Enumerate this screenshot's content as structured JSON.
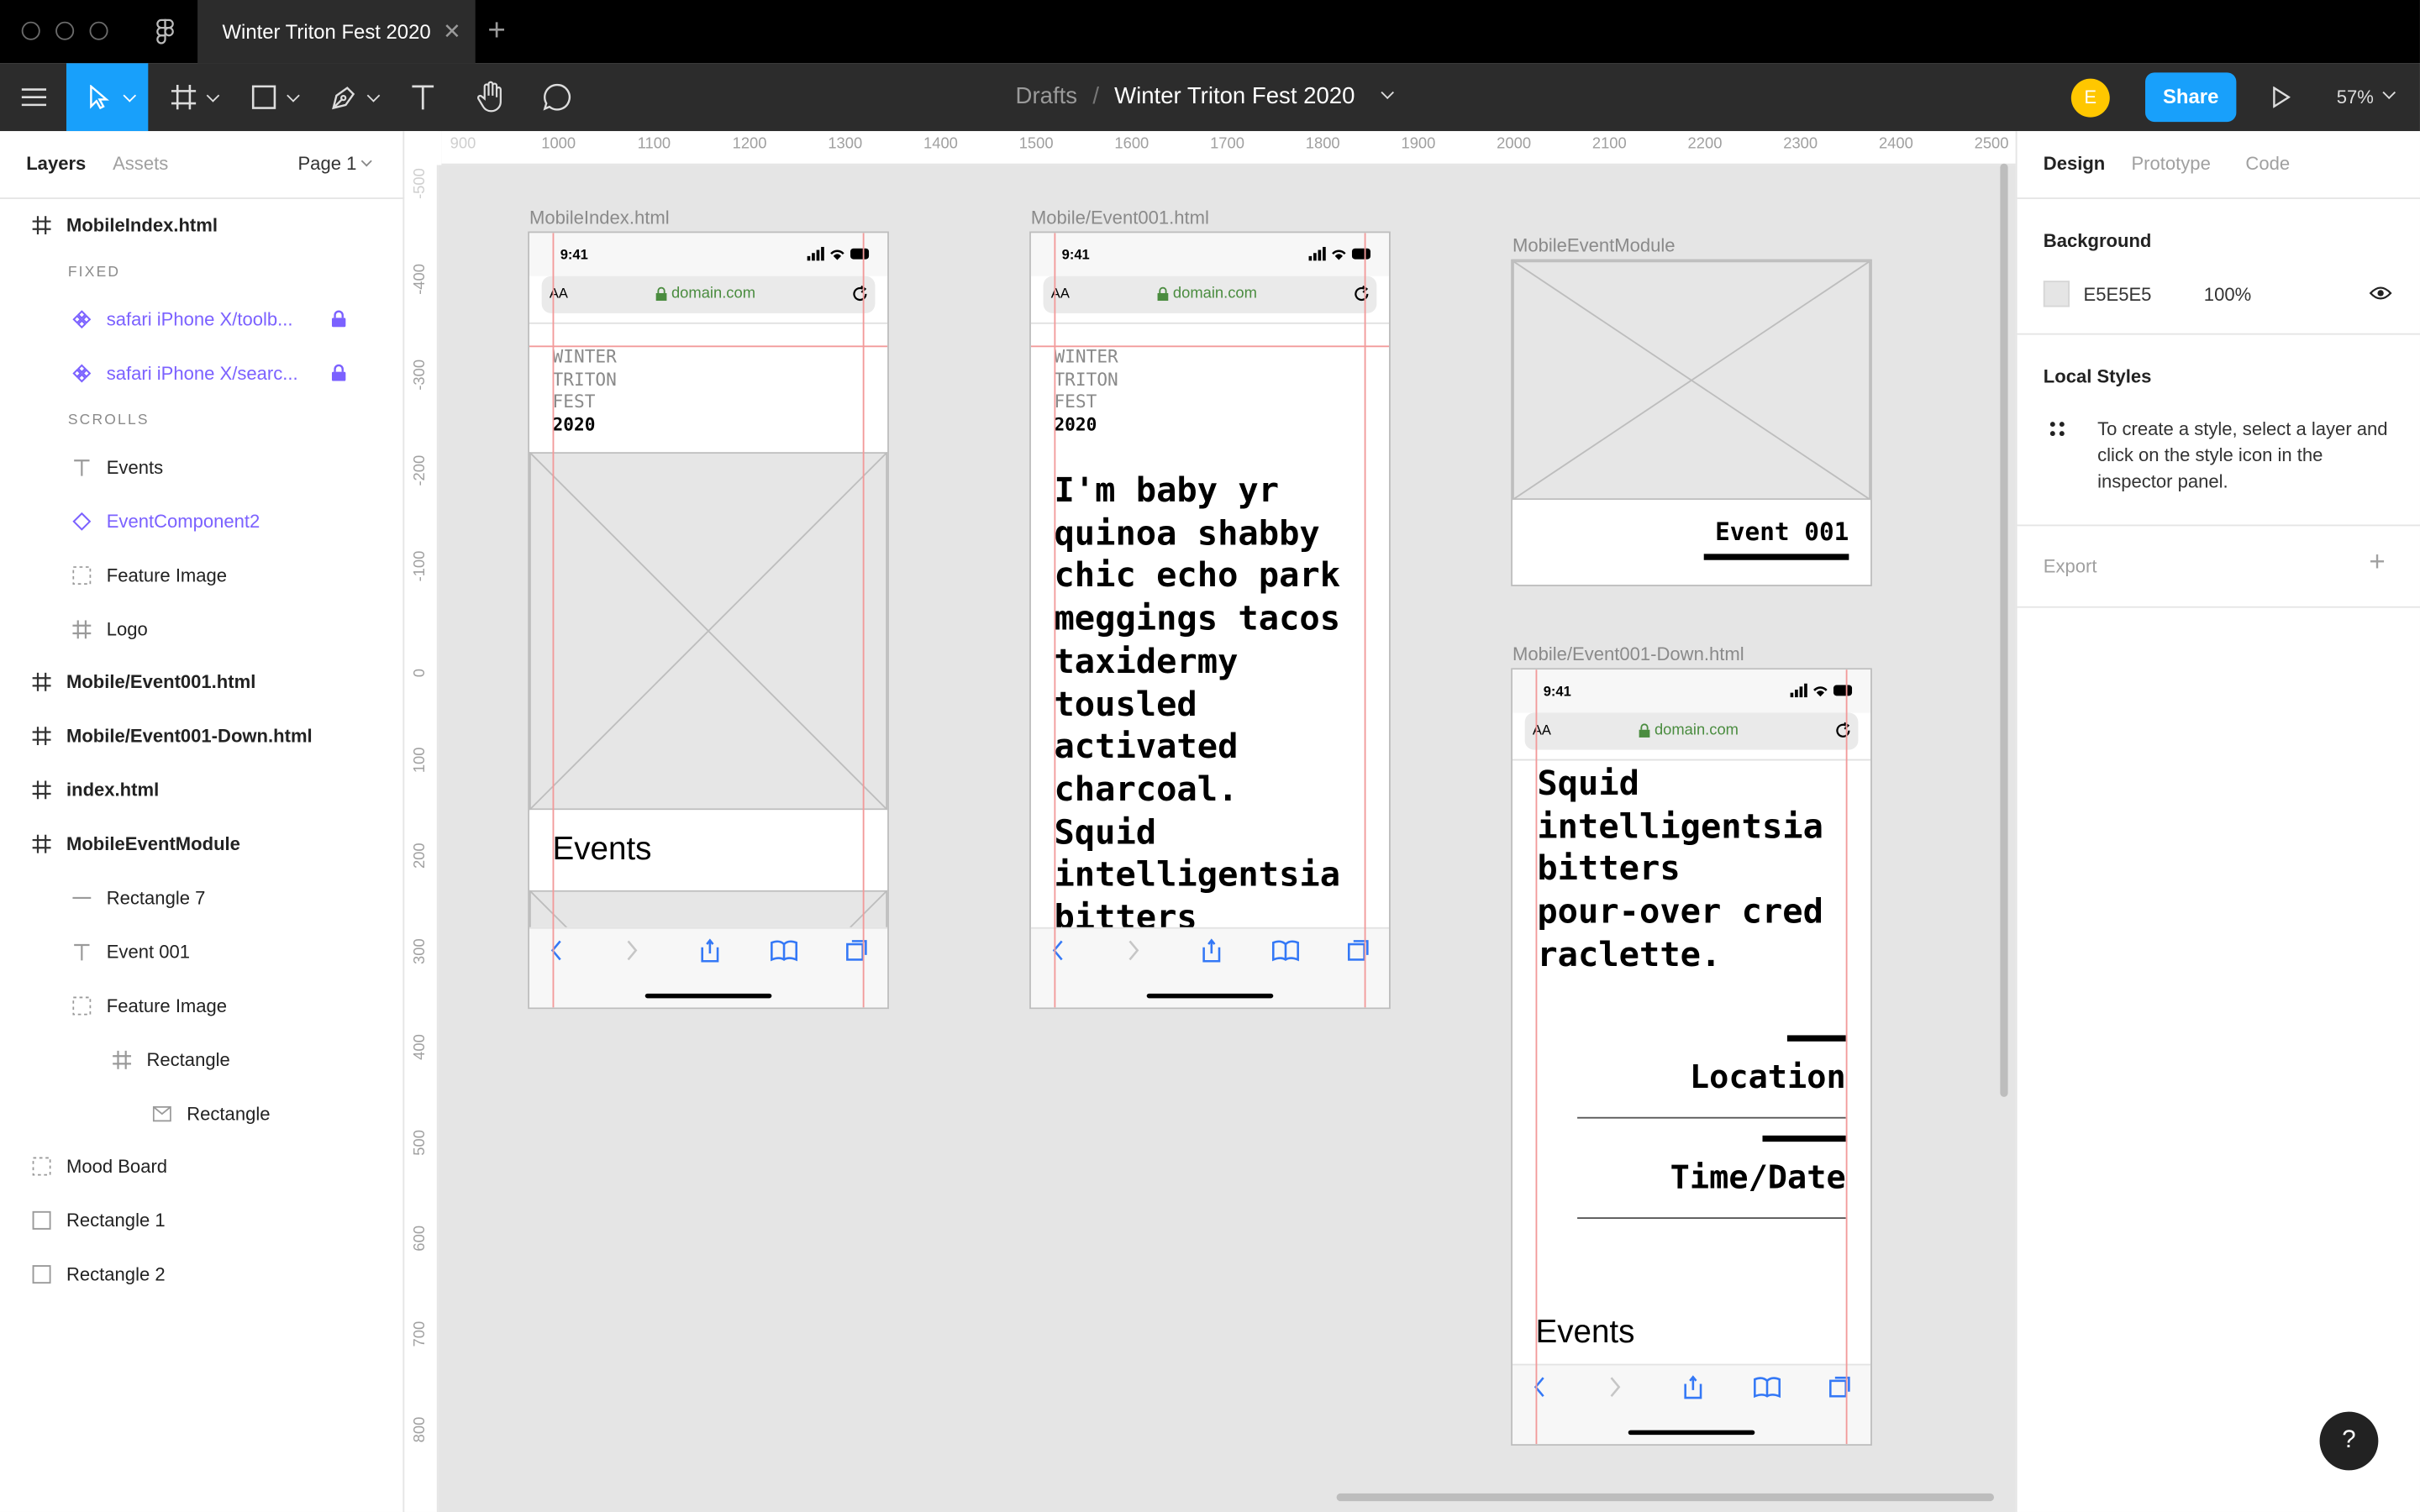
{
  "tab": {
    "title": "Winter Triton Fest 2020",
    "close": "✕",
    "add": "+"
  },
  "toolbar": {
    "breadcrumb_parent": "Drafts",
    "breadcrumb_sep": "/",
    "file_name": "Winter Triton Fest 2020",
    "avatar_initial": "E",
    "share_label": "Share",
    "zoom": "57%"
  },
  "left_panel": {
    "tabs": [
      "Layers",
      "Assets"
    ],
    "page": "Page 1",
    "layers": [
      {
        "label": "MobileIndex.html",
        "icon": "frame-icon",
        "bold": true
      },
      {
        "section": "FIXED"
      },
      {
        "label": "safari iPhone X/toolb...",
        "icon": "instance-icon",
        "purple": true,
        "locked": true
      },
      {
        "label": "safari iPhone X/searc...",
        "icon": "instance-icon",
        "purple": true,
        "locked": true
      },
      {
        "section": "SCROLLS"
      },
      {
        "label": "Events",
        "icon": "text-icon"
      },
      {
        "label": "EventComponent2",
        "icon": "component-icon",
        "purple": true
      },
      {
        "label": "Feature Image",
        "icon": "group-icon"
      },
      {
        "label": "Logo",
        "icon": "frame-icon"
      },
      {
        "label": "Mobile/Event001.html",
        "icon": "frame-icon",
        "bold": true
      },
      {
        "label": "Mobile/Event001-Down.html",
        "icon": "frame-icon",
        "bold": true
      },
      {
        "label": "index.html",
        "icon": "frame-icon",
        "bold": true
      },
      {
        "label": "MobileEventModule",
        "icon": "frame-icon",
        "bold": true
      },
      {
        "label": "Rectangle 7",
        "icon": "line-icon"
      },
      {
        "label": "Event 001",
        "icon": "text-icon"
      },
      {
        "label": "Feature Image",
        "icon": "group-icon"
      },
      {
        "label": "Rectangle",
        "icon": "frame-icon"
      },
      {
        "label": "Rectangle",
        "icon": "image-icon"
      },
      {
        "label": "Mood Board",
        "icon": "group-icon"
      },
      {
        "label": "Rectangle 1",
        "icon": "rect-icon"
      },
      {
        "label": "Rectangle 2",
        "icon": "rect-icon"
      }
    ]
  },
  "ruler": {
    "h": [
      "900",
      "1000",
      "1100",
      "1200",
      "1300",
      "1400",
      "1500",
      "1600",
      "1700",
      "1800",
      "1900",
      "2000",
      "2100",
      "2200",
      "2300",
      "2400",
      "2500"
    ],
    "v": [
      "-500",
      "-400",
      "-300",
      "-200",
      "-100",
      "0",
      "100",
      "200",
      "300",
      "400",
      "500",
      "600",
      "700",
      "800"
    ]
  },
  "canvas": {
    "frames": {
      "index": {
        "label": "MobileIndex.html",
        "time": "9:41",
        "aa": "AA",
        "domain": "domain.com",
        "logo": [
          "WINTER",
          "TRITON",
          "FEST",
          "2020"
        ],
        "events": "Events"
      },
      "event001": {
        "label": "Mobile/Event001.html",
        "time": "9:41",
        "aa": "AA",
        "domain": "domain.com",
        "logo": [
          "WINTER",
          "TRITON",
          "FEST",
          "2020"
        ],
        "body": [
          "I'm baby yr",
          "quinoa shabby",
          "chic echo park",
          "meggings tacos",
          "taxidermy",
          "tousled",
          "activated",
          "charcoal.",
          "Squid",
          "intelligentsia",
          "bitters"
        ]
      },
      "module": {
        "label": "MobileEventModule",
        "event": "Event 001"
      },
      "down": {
        "label": "Mobile/Event001-Down.html",
        "time": "9:41",
        "aa": "AA",
        "domain": "domain.com",
        "body": [
          "Squid",
          "intelligentsia",
          "bitters",
          "pour-over cred",
          "raclette."
        ],
        "location": "Location",
        "time_date": "Time/Date",
        "events": "Events"
      }
    }
  },
  "right_panel": {
    "tabs": [
      "Design",
      "Prototype",
      "Code"
    ],
    "background_title": "Background",
    "bg_hex": "E5E5E5",
    "bg_opacity": "100%",
    "bg_color": "#E5E5E5",
    "local_styles_title": "Local Styles",
    "local_styles_hint": "To create a style, select a layer and click on the style icon in the inspector panel.",
    "export_title": "Export",
    "export_add": "+"
  },
  "help": "?",
  "colors": {
    "accent": "#18a0fb",
    "purple": "#7b61ff",
    "toolbar": "#2c2c2c",
    "guide": "#f29a9a"
  }
}
